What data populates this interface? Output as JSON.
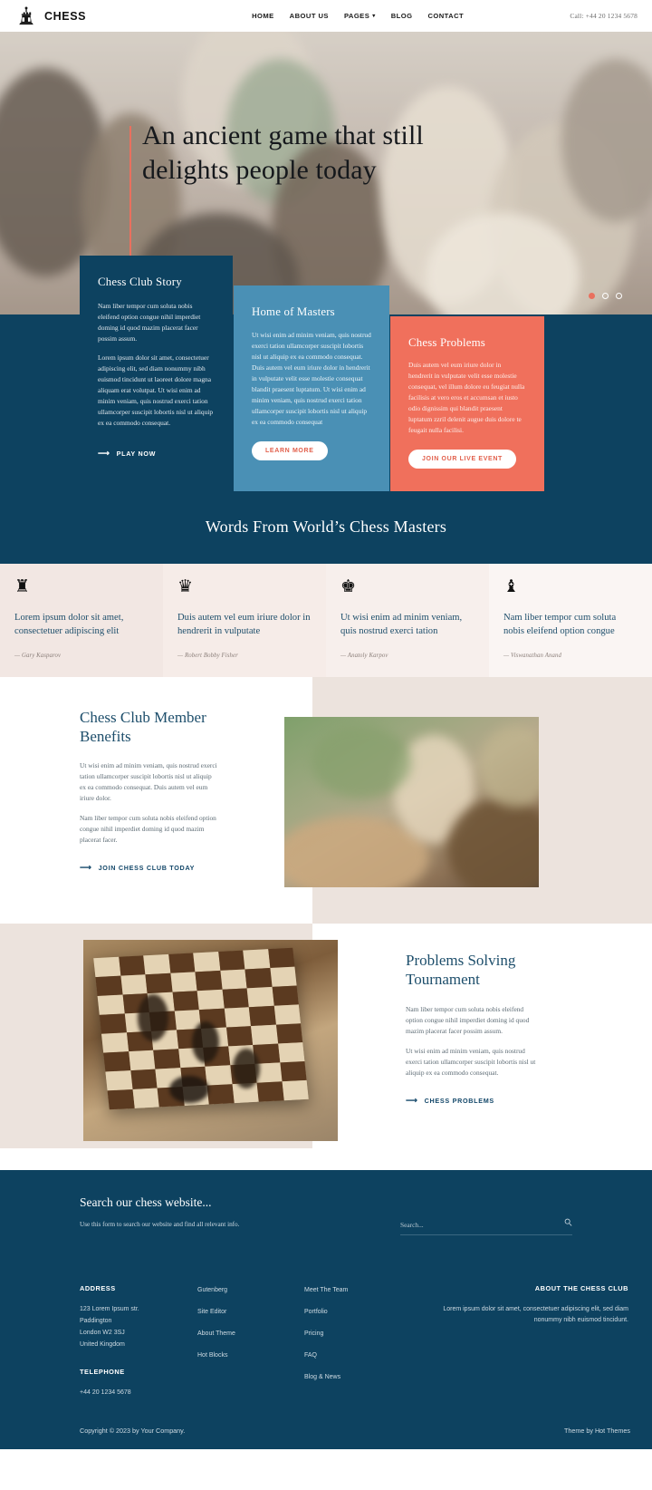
{
  "header": {
    "brand": "CHESS",
    "logo_icon": "chess-rook-logo-icon",
    "nav": [
      {
        "label": "HOME",
        "has_caret": false
      },
      {
        "label": "ABOUT US",
        "has_caret": false
      },
      {
        "label": "PAGES",
        "has_caret": true
      },
      {
        "label": "BLOG",
        "has_caret": false
      },
      {
        "label": "CONTACT",
        "has_caret": false
      }
    ],
    "phone": "Call: +44 20 1234 5678"
  },
  "hero": {
    "title": "An ancient game that still delights people today",
    "slides": 3,
    "active_slide": 1
  },
  "cards": {
    "story": {
      "title": "Chess Club Story",
      "p1": "Nam liber tempor cum soluta nobis eleifend option congue nihil imperdiet doming id quod mazim placerat facer possim assum.",
      "p2": "Lorem ipsum dolor sit amet, consectetuer adipiscing elit, sed diam nonummy nibh euismod tincidunt ut laoreet dolore magna aliquam erat volutpat. Ut wisi enim ad minim veniam, quis nostrud exerci tation ullamcorper suscipit lobortis nisl ut aliquip ex ea commodo consequat.",
      "cta": "PLAY NOW"
    },
    "masters": {
      "title": "Home of Masters",
      "p1": "Ut wisi enim ad minim veniam, quis nostrud exerci tation ullamcorper suscipit lobortis nisl ut aliquip ex ea commodo consequat. Duis autem vel eum iriure dolor in hendrerit in vulputate velit esse molestie consequat blandit praesent luptatum.  Ut wisi enim ad minim veniam, quis nostrud exerci tation ullamcorper suscipit lobortis nisl ut aliquip ex ea commodo consequat",
      "cta": "LEARN MORE"
    },
    "problems": {
      "title": "Chess Problems",
      "p1": "Duis autem vel eum iriure dolor in hendrerit in vulputate velit esse molestie consequat, vel illum dolore eu feugiat nulla facilisis at vero eros et accumsan et iusto odio dignissim qui blandit praesent luptatum zzril delenit augue duis dolore te feugait nulla facilisi.",
      "cta": "JOIN OUR LIVE EVENT"
    }
  },
  "masters_section": {
    "heading": "Words From World’s Chess Masters",
    "quotes": [
      {
        "piece": "♜",
        "piece_name": "chess-rook-icon",
        "text": "Lorem ipsum dolor sit amet, consectetuer adipiscing elit",
        "author": "— Gary Kasparov"
      },
      {
        "piece": "♛",
        "piece_name": "chess-queen-icon",
        "text": "Duis autem vel eum iriure dolor in hendrerit in vulputate",
        "author": "— Robert Bobby Fisher"
      },
      {
        "piece": "♚",
        "piece_name": "chess-king-icon",
        "text": "Ut wisi enim ad minim veniam, quis nostrud exerci tation",
        "author": "— Anatoly Karpov"
      },
      {
        "piece": "♝",
        "piece_name": "chess-bishop-icon",
        "text": "Nam liber tempor cum soluta nobis eleifend option congue",
        "author": "— Viswanathan Anand"
      }
    ]
  },
  "benefits": {
    "title": "Chess Club Member Benefits",
    "p1": "Ut wisi enim ad minim veniam, quis nostrud exerci tation ullamcorper suscipit lobortis nisl ut aliquip ex ea commodo consequat. Duis autem vel eum iriure dolor.",
    "p2": "Nam liber tempor cum soluta nobis eleifend option congue nihil imperdiet doming id quod mazim placerat facer.",
    "cta": "JOIN CHESS CLUB TODAY",
    "image_name": "chess-hand-moving-piece-photo"
  },
  "tournament": {
    "title": "Problems Solving Tournament",
    "p1": "Nam liber tempor cum soluta nobis eleifend option congue nihil imperdiet doming id quod mazim placerat facer possim assum.",
    "p2": "Ut wisi enim ad minim veniam, quis nostrud exerci tation ullamcorper suscipit lobortis nisl ut aliquip ex ea commodo consequat.",
    "cta": "CHESS PROBLEMS",
    "image_name": "wooden-chessboard-photo"
  },
  "search": {
    "title": "Search our chess website...",
    "subtitle": "Use this form to search our website and find all relevant info.",
    "placeholder": "Search...",
    "value": "",
    "icon": "search-icon"
  },
  "footer": {
    "address_title": "ADDRESS",
    "address_lines": "123 Lorem Ipsum str.\nPaddington\nLondon W2 3SJ\nUnited Kingdom",
    "telephone_title": "TELEPHONE",
    "telephone": "+44 20 1234 5678",
    "links_col2": [
      "Gutenberg",
      "Site Editor",
      "About Theme",
      "Hot Blocks"
    ],
    "links_col3": [
      "Meet The Team",
      "Portfolio",
      "Pricing",
      "FAQ",
      "Blog & News"
    ],
    "about_title": "ABOUT THE CHESS CLUB",
    "about_text": "Lorem ipsum dolor sit amet, consectetuer adipiscing elit, sed diam nonummy nibh euismod tincidunt.",
    "copyright": "Copyright © 2023 by Your Company.",
    "credit": "Theme by Hot Themes"
  },
  "colors": {
    "navy": "#0d4260",
    "blue": "#4a90b5",
    "coral": "#f0705c",
    "cream": "#ece3dd",
    "accent_text": "#1d4e6b"
  }
}
